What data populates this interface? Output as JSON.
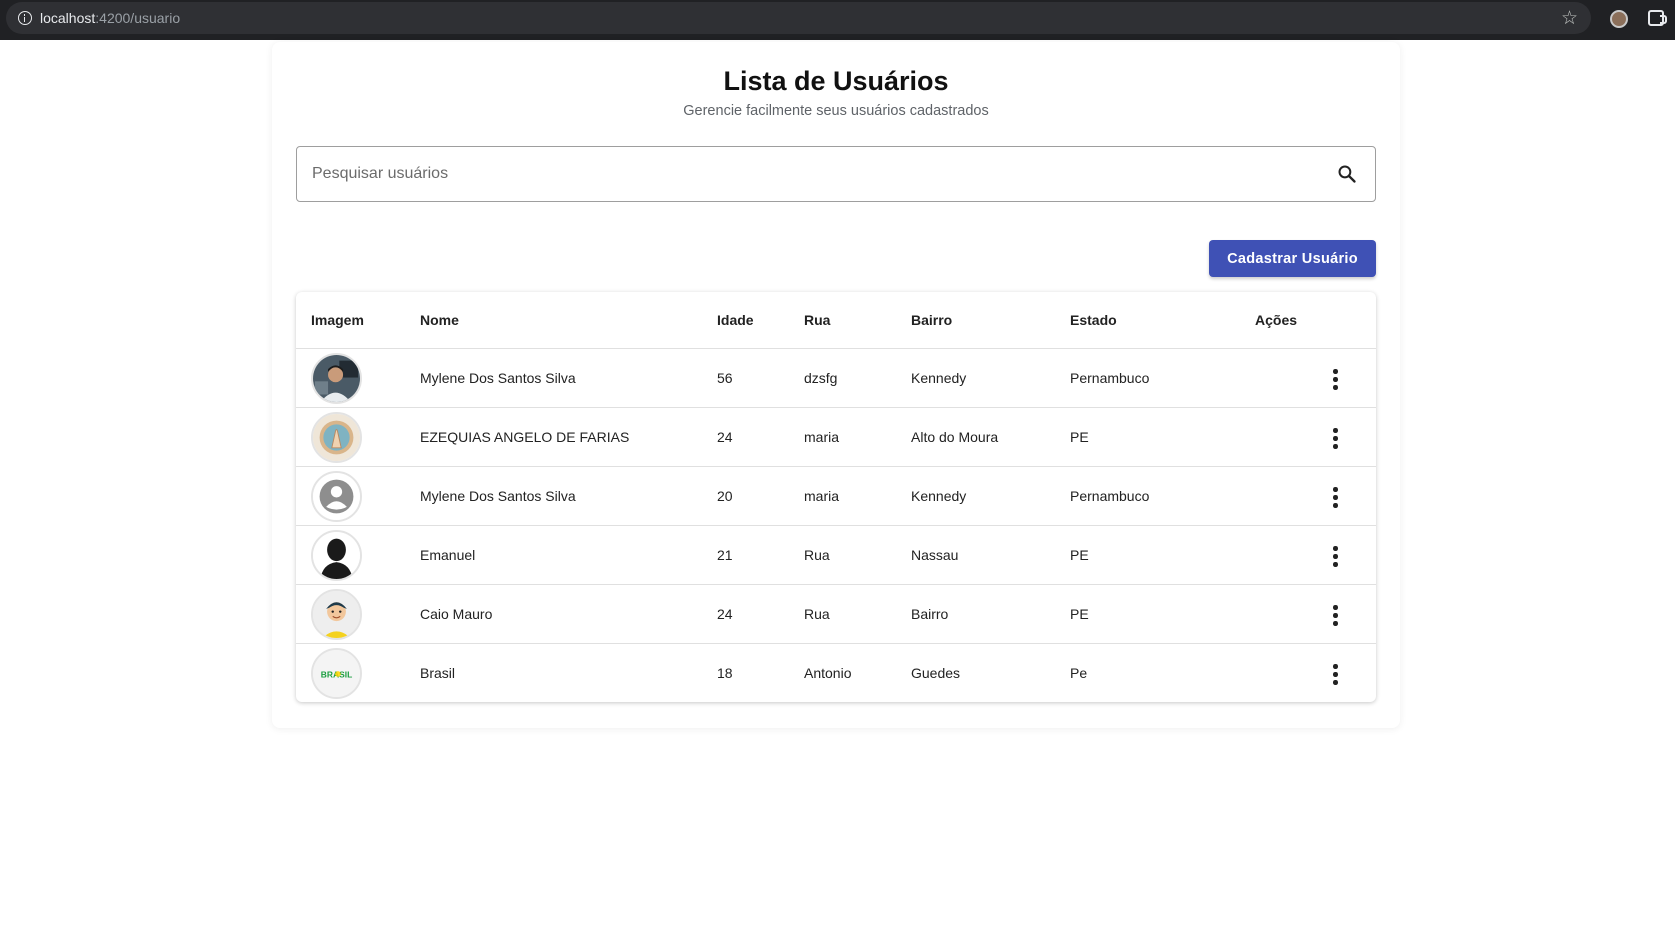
{
  "browser": {
    "url_host": "localhost",
    "url_path": ":4200/usuario"
  },
  "page": {
    "title": "Lista de Usuários",
    "subtitle": "Gerencie facilmente seus usuários cadastrados"
  },
  "search": {
    "placeholder": "Pesquisar usuários",
    "value": ""
  },
  "actions": {
    "add_label": "Cadastrar Usuário"
  },
  "table": {
    "columns": [
      "Imagem",
      "Nome",
      "Idade",
      "Rua",
      "Bairro",
      "Estado",
      "Ações"
    ],
    "rows": [
      {
        "nome": "Mylene Dos Santos Silva",
        "idade": "56",
        "rua": "dzsfg",
        "bairro": "Kennedy",
        "estado": "Pernambuco",
        "avatar": "photo-man-icon"
      },
      {
        "nome": "EZEQUIAS ANGELO DE FARIAS",
        "idade": "24",
        "rua": "maria",
        "bairro": "Alto do Moura",
        "estado": "PE",
        "avatar": "praying-hands-icon"
      },
      {
        "nome": "Mylene Dos Santos Silva",
        "idade": "20",
        "rua": "maria",
        "bairro": "Kennedy",
        "estado": "Pernambuco",
        "avatar": "default-user-icon"
      },
      {
        "nome": "Emanuel",
        "idade": "21",
        "rua": "Rua",
        "bairro": "Nassau",
        "estado": "PE",
        "avatar": "silhouette-icon"
      },
      {
        "nome": "Caio Mauro",
        "idade": "24",
        "rua": "Rua",
        "bairro": "Bairro",
        "estado": "PE",
        "avatar": "cartoon-boy-icon"
      },
      {
        "nome": "Brasil",
        "idade": "18",
        "rua": "Antonio",
        "bairro": "Guedes",
        "estado": "Pe",
        "avatar": "brasil-logo-icon"
      }
    ]
  },
  "colors": {
    "primary": "#3f51b5",
    "browser_bar": "#202124"
  }
}
